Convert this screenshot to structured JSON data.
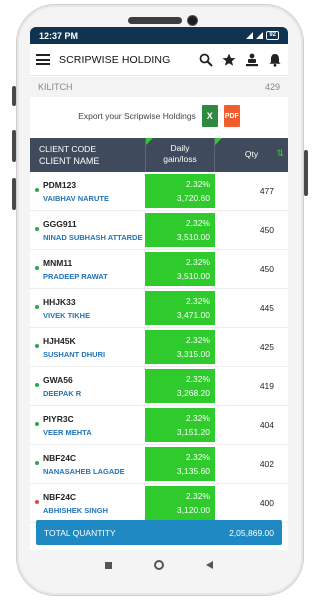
{
  "status_bar": {
    "time": "12:37 PM",
    "battery": "92"
  },
  "header": {
    "title": "SCRIPWISE HOLDING"
  },
  "account": {
    "name": "KILITCH",
    "count": "429"
  },
  "export": {
    "label": "Export your Scripwise Holdings",
    "excel": "X",
    "pdf": "PDF"
  },
  "table": {
    "col_code": "CLIENT CODE",
    "col_name": "CLIENT NAME",
    "col_gain_1": "Daily",
    "col_gain_2": "gain/loss",
    "col_qty": "Qty",
    "sort_symbol": "⇅"
  },
  "rows": [
    {
      "code": "PDM123",
      "name": "VAIBHAV NARUTE",
      "pct": "2.32%",
      "amt": "3,720.60",
      "qty": "477",
      "dot": "green"
    },
    {
      "code": "GGG911",
      "name": "NINAD SUBHASH ATTARDE",
      "pct": "2.32%",
      "amt": "3,510.00",
      "qty": "450",
      "dot": "green"
    },
    {
      "code": "MNM11",
      "name": "PRADEEP RAWAT",
      "pct": "2.32%",
      "amt": "3,510.00",
      "qty": "450",
      "dot": "green"
    },
    {
      "code": "HHJK33",
      "name": "VIVEK TIKHE",
      "pct": "2.32%",
      "amt": "3,471.00",
      "qty": "445",
      "dot": "green"
    },
    {
      "code": "HJH45K",
      "name": "SUSHANT DHURI",
      "pct": "2.32%",
      "amt": "3,315.00",
      "qty": "425",
      "dot": "green"
    },
    {
      "code": "GWA56",
      "name": "DEEPAK R",
      "pct": "2.32%",
      "amt": "3,268.20",
      "qty": "419",
      "dot": "green"
    },
    {
      "code": "PIYR3C",
      "name": "VEER MEHTA",
      "pct": "2.32%",
      "amt": "3,151.20",
      "qty": "404",
      "dot": "green"
    },
    {
      "code": "NBF24C",
      "name": "NANASAHEB LAGADE",
      "pct": "2.32%",
      "amt": "3,135.60",
      "qty": "402",
      "dot": "green"
    },
    {
      "code": "NBF24C",
      "name": "ABHISHEK SINGH",
      "pct": "2.32%",
      "amt": "3,120.00",
      "qty": "400",
      "dot": "red"
    }
  ],
  "total": {
    "label": "TOTAL QUANTITY",
    "value": "2,05,869.00"
  },
  "colors": {
    "header_bg": "#0f3350",
    "table_head": "#3f4b5c",
    "gain_green": "#2fcb2c",
    "name_blue": "#2274b8",
    "total_bar": "#1e89c3"
  }
}
